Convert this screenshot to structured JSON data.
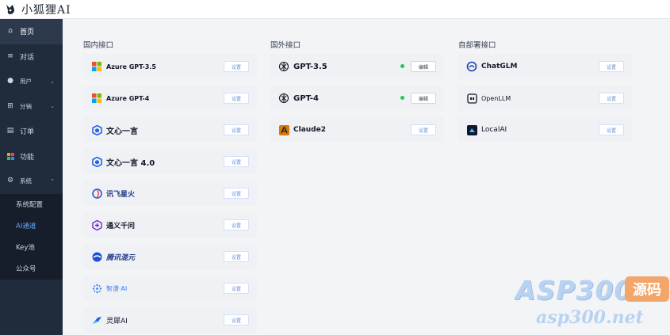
{
  "app": {
    "title": "小狐狸AI"
  },
  "sidebar": {
    "items": [
      {
        "label": "首页",
        "icon": "home-icon",
        "active": true
      },
      {
        "label": "对话",
        "icon": "list-icon"
      },
      {
        "label": "用户",
        "icon": "user-icon",
        "has_children": true
      },
      {
        "label": "分销",
        "icon": "share-icon",
        "has_children": true
      },
      {
        "label": "订单",
        "icon": "order-icon"
      },
      {
        "label": "功能",
        "icon": "apps-icon"
      },
      {
        "label": "系统",
        "icon": "settings-icon",
        "expanded": true
      }
    ],
    "submenu": [
      {
        "label": "系统配置"
      },
      {
        "label": "AI通道",
        "active": true
      },
      {
        "label": "Key池"
      },
      {
        "label": "公众号"
      }
    ]
  },
  "sections": {
    "domestic": {
      "title": "国内接口",
      "items": [
        {
          "name": "Azure GPT-3.5",
          "icon": "microsoft-icon",
          "button": "设置"
        },
        {
          "name": "Azure GPT-4",
          "icon": "microsoft-icon",
          "button": "设置"
        },
        {
          "name": "文心一言",
          "icon": "wenxin-icon",
          "button": "设置"
        },
        {
          "name": "文心一言 4.0",
          "icon": "wenxin-icon",
          "button": "设置"
        },
        {
          "name": "讯飞星火",
          "icon": "xunfei-icon",
          "button": "设置"
        },
        {
          "name": "通义千问",
          "icon": "tongyi-icon",
          "button": "设置"
        },
        {
          "name": "腾讯混元",
          "icon": "hunyuan-icon",
          "button": "设置"
        },
        {
          "name": "智谱·AI",
          "icon": "zhipu-icon",
          "button": "设置"
        },
        {
          "name": "灵犀AI",
          "icon": "lingxi-icon",
          "button": "设置"
        }
      ]
    },
    "foreign": {
      "title": "国外接口",
      "items": [
        {
          "name": "GPT-3.5",
          "icon": "openai-icon",
          "button": "编辑",
          "status": "enabled"
        },
        {
          "name": "GPT-4",
          "icon": "openai-icon",
          "button": "编辑",
          "status": "enabled"
        },
        {
          "name": "Claude2",
          "icon": "anthropic-icon",
          "button": "设置"
        }
      ]
    },
    "selfhosted": {
      "title": "自部署接口",
      "items": [
        {
          "name": "ChatGLM",
          "icon": "chatglm-icon",
          "button": "设置"
        },
        {
          "name": "OpenLLM",
          "icon": "openllm-icon",
          "button": "设置"
        },
        {
          "name": "LocalAI",
          "icon": "localai-icon",
          "button": "设置"
        }
      ]
    }
  },
  "watermark": {
    "brand": "ASP300",
    "badge": "源码",
    "url": "asp300.net"
  },
  "colors": {
    "sidebar_bg": "#202b3b",
    "accent": "#60a5fa",
    "status_green": "#22c55e"
  }
}
